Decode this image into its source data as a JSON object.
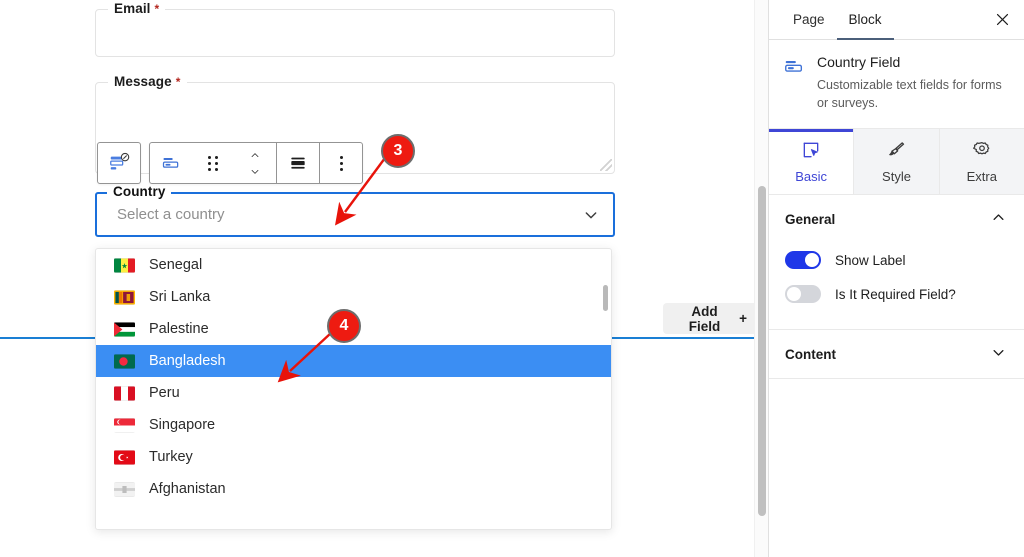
{
  "canvas": {
    "fields": [
      {
        "label": "Email",
        "required": true,
        "type": "input",
        "value": "",
        "placeholder": ""
      },
      {
        "label": "Message",
        "required": true,
        "type": "textarea",
        "value": "",
        "placeholder": ""
      }
    ],
    "country_field": {
      "label": "Country",
      "placeholder": "Select a country",
      "value": "",
      "chevron_icon": "chevron-down-icon",
      "border_color": "#1a6fdb"
    },
    "add_field_button": {
      "label": "Add Field",
      "plus": "+"
    },
    "insertion_line_color": "#1a7fd4"
  },
  "block_toolbar": {
    "buttons": [
      {
        "name": "change-block-type",
        "icon": "form-block-icon"
      },
      {
        "name": "country-field-icon",
        "icon": "field-icon"
      },
      {
        "name": "drag-handle",
        "icon": "six-dots-icon"
      },
      {
        "name": "move-up-down",
        "icon": "chevron-up-down-icon"
      },
      {
        "name": "align",
        "icon": "align-icon"
      },
      {
        "name": "more-options",
        "icon": "three-dots-vertical-icon"
      }
    ]
  },
  "dropdown": {
    "options": [
      {
        "label": "Senegal",
        "flag": "senegal-flag",
        "selected": false
      },
      {
        "label": "Sri Lanka",
        "flag": "sri-lanka-flag",
        "selected": false
      },
      {
        "label": "Palestine",
        "flag": "palestine-flag",
        "selected": false
      },
      {
        "label": "Bangladesh",
        "flag": "bangladesh-flag",
        "selected": true
      },
      {
        "label": "Peru",
        "flag": "peru-flag",
        "selected": false
      },
      {
        "label": "Singapore",
        "flag": "singapore-flag",
        "selected": false
      },
      {
        "label": "Turkey",
        "flag": "turkey-flag",
        "selected": false
      },
      {
        "label": "Afghanistan",
        "flag": "afghanistan-flag",
        "selected": false
      }
    ],
    "highlight_color": "#3b8ef3"
  },
  "inspector": {
    "tabs": [
      {
        "label": "Page",
        "active": false
      },
      {
        "label": "Block",
        "active": true
      }
    ],
    "close_icon": "close-icon",
    "block": {
      "icon": "country-field-icon",
      "title": "Country Field",
      "description": "Customizable text fields for forms or surveys."
    },
    "segments": [
      {
        "label": "Basic",
        "icon": "cursor-box-icon",
        "active": true
      },
      {
        "label": "Style",
        "icon": "paintbrush-icon",
        "active": false
      },
      {
        "label": "Extra",
        "icon": "gear-icon",
        "active": false
      }
    ],
    "sections": [
      {
        "title": "General",
        "collapse_icon": "chevron-up-icon",
        "expanded": true,
        "toggles": [
          {
            "label": "Show Label",
            "on": true
          },
          {
            "label": "Is It Required Field?",
            "on": false
          }
        ]
      },
      {
        "title": "Content",
        "collapse_icon": "chevron-down-icon",
        "expanded": false,
        "toggles": []
      }
    ],
    "accent_color": "#3f46d6",
    "toggle_on_color": "#1f37e8"
  },
  "callouts": [
    {
      "number": "3"
    },
    {
      "number": "4"
    }
  ]
}
